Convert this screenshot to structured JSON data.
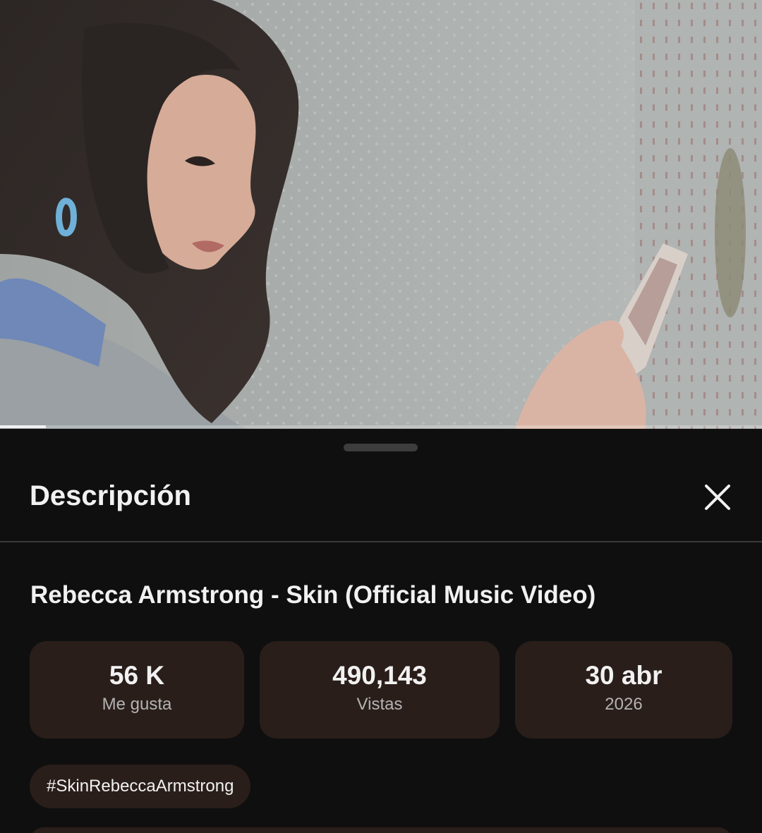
{
  "video": {
    "progress_fraction": 0.06
  },
  "sheet": {
    "title": "Descripción",
    "close_icon": "close-icon"
  },
  "video_info": {
    "title": "Rebecca Armstrong - Skin (Official Music Video)",
    "stats": {
      "likes": {
        "value": "56 K",
        "label": "Me gusta"
      },
      "views": {
        "value": "490,143",
        "label": "Vistas"
      },
      "date": {
        "value": "30 abr",
        "label": "2026"
      }
    },
    "hashtag": "#SkinRebeccaArmstrong"
  },
  "colors": {
    "background": "#0f0f0f",
    "chip_background": "#2a1e1a",
    "text_primary": "#f1f1f1",
    "text_secondary": "#b3b3b3"
  }
}
